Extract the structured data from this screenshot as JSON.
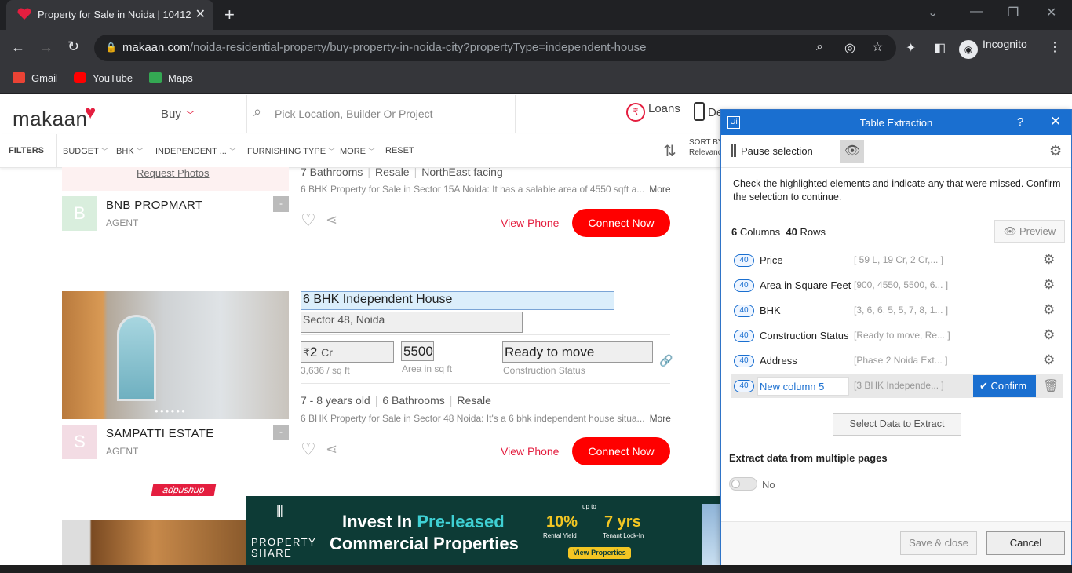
{
  "browser": {
    "tab_title": "Property for Sale in Noida | 10412",
    "url_domain": "makaan.com",
    "url_path": "/noida-residential-property/buy-property-in-noida-city?propertyType=independent-house",
    "incognito_label": "Incognito",
    "bookmarks": [
      {
        "label": "Gmail",
        "icon": "gmail-icon",
        "color": "#ea4335"
      },
      {
        "label": "YouTube",
        "icon": "youtube-icon",
        "color": "#ff0000"
      },
      {
        "label": "Maps",
        "icon": "maps-icon",
        "color": "#34a853"
      }
    ]
  },
  "site": {
    "logo": "makaan",
    "buy_label": "Buy",
    "search_placeholder": "Pick Location, Builder Or Project",
    "loans_label": "Loans",
    "download_label": "De",
    "accent": "#e41e3f"
  },
  "filters": {
    "label": "FILTERS",
    "items": [
      "BUDGET",
      "BHK",
      "INDEPENDENT ...",
      "FURNISHING TYPE",
      "MORE",
      "RESET"
    ],
    "sort_label": "SORT BY",
    "sort_value": "Relevanc"
  },
  "listing1": {
    "request_photos": "Request Photos",
    "details": [
      "7 Bathrooms",
      "Resale",
      "NorthEast facing"
    ],
    "description": "6 BHK Property for Sale in Sector 15A Noida: It has a salable area of 4550 sqft a...",
    "more": "More",
    "agent_initial": "B",
    "agent_name": "BNB PROPMART",
    "agent_role": "AGENT",
    "view_phone": "View Phone",
    "connect": "Connect Now"
  },
  "listing2": {
    "title": "6 BHK Independent House",
    "location": "Sector 48, Noida",
    "currency": "₹",
    "price_value": "2",
    "price_unit": "Cr",
    "price_per_sqft": "3,636 / sq ft",
    "area_value": "5500",
    "area_label": "Area in sq ft",
    "status_value": "Ready to move",
    "status_label": "Construction Status",
    "details": [
      "7 - 8 years old",
      "6 Bathrooms",
      "Resale"
    ],
    "description": "6 BHK Property for Sale in Sector 48 Noida: It's a 6 bhk independent house situa...",
    "more": "More",
    "agent_initial": "S",
    "agent_name": "SAMPATTI ESTATE",
    "agent_role": "AGENT",
    "view_phone": "View Phone",
    "connect": "Connect Now"
  },
  "ads": {
    "adpushup": "adpushup",
    "brand_line1": "PROPERTY",
    "brand_line2": "SHARE",
    "headline_prefix": "Invest In ",
    "headline_highlight": "Pre-leased",
    "headline2": "Commercial Properties",
    "upto": "up to",
    "stat1": "10%",
    "stat1_label": "Rental Yield",
    "stat2": "7 yrs",
    "stat2_label": "Tenant Lock-In",
    "cta": "View Properties"
  },
  "panel": {
    "title": "Table Extraction",
    "help": "?",
    "pause_label": "Pause selection",
    "instructions": "Check the highlighted elements and indicate any that were missed. Confirm the selection to continue.",
    "columns_count": "6",
    "columns_word": "Columns",
    "rows_count": "40",
    "rows_word": "Rows",
    "preview_label": "Preview",
    "columns": [
      {
        "count": "40",
        "name": "Price",
        "sample": "[ 59 L,  19 Cr,  2 Cr,... ]"
      },
      {
        "count": "40",
        "name": "Area in Square Feet",
        "sample": "[900, 4550, 5500, 6... ]"
      },
      {
        "count": "40",
        "name": "BHK",
        "sample": "[3, 6, 6, 5, 5, 7, 8, 1... ]"
      },
      {
        "count": "40",
        "name": "Construction Status",
        "sample": "[Ready to move, Re... ]"
      },
      {
        "count": "40",
        "name": "Address",
        "sample": "[Phase 2 Noida Ext... ]"
      }
    ],
    "edit_row": {
      "count": "40",
      "value": "New column 5",
      "sample": "[3 BHK Independe... ]",
      "confirm": "Confirm"
    },
    "select_data": "Select Data to Extract",
    "multi_pages": "Extract data from multiple pages",
    "toggle_label": "No",
    "save_close": "Save & close",
    "cancel": "Cancel",
    "accent": "#1a6fd0"
  }
}
